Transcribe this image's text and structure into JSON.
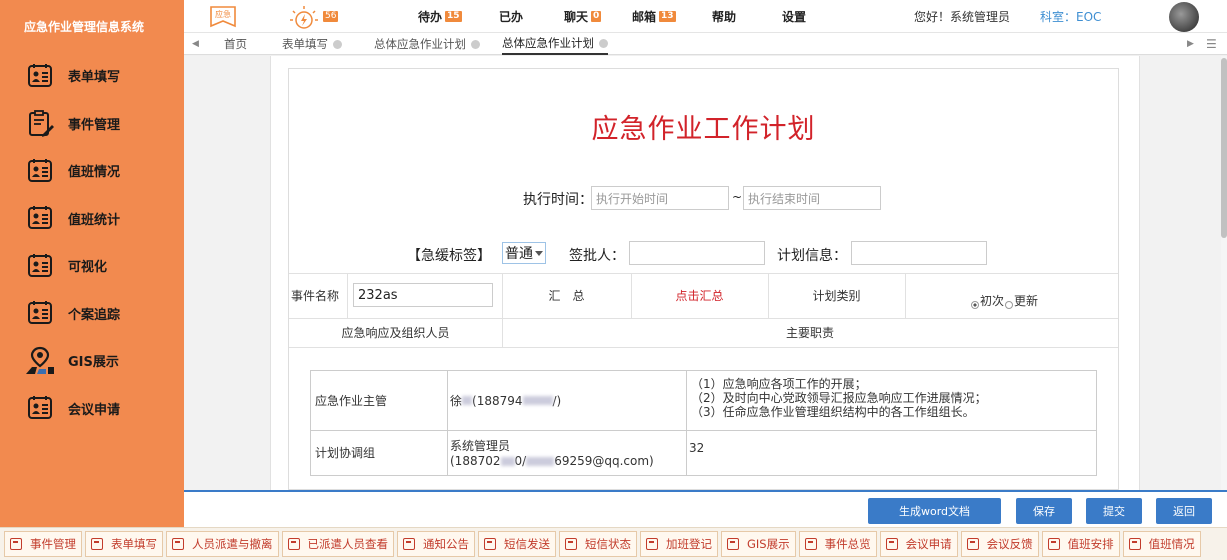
{
  "app": {
    "title": "应急作业管理信息系统"
  },
  "sidebar": {
    "items": [
      {
        "label": "表单填写",
        "icon": "form-icon"
      },
      {
        "label": "事件管理",
        "icon": "clipboard-edit-icon"
      },
      {
        "label": "值班情况",
        "icon": "form-icon"
      },
      {
        "label": "值班统计",
        "icon": "form-icon"
      },
      {
        "label": "可视化",
        "icon": "form-icon"
      },
      {
        "label": "个案追踪",
        "icon": "form-icon"
      },
      {
        "label": "GIS展示",
        "icon": "map-pin-icon"
      },
      {
        "label": "会议申请",
        "icon": "form-icon"
      }
    ]
  },
  "header": {
    "emergency_icon_text": "应急",
    "alarm_count": "56",
    "todo_label": "待办",
    "todo_count": "15",
    "done_label": "已办",
    "chat_label": "聊天",
    "chat_count": "0",
    "mail_label": "邮箱",
    "mail_count": "13",
    "help_label": "帮助",
    "settings_label": "设置",
    "greeting": "您好！系统管理员",
    "dept": "科室：EOC"
  },
  "tabs": [
    {
      "label": "首页"
    },
    {
      "label": "表单填写"
    },
    {
      "label": "总体应急作业计划"
    },
    {
      "label": "总体应急作业计划"
    }
  ],
  "form": {
    "title": "应急作业工作计划",
    "exec_time_label": "执行时间：",
    "exec_start_placeholder": "执行开始时间",
    "exec_separator": "~",
    "exec_end_placeholder": "执行结束时间",
    "urgency_label": "【急缓标签】",
    "urgency_value": "普通",
    "approver_label": "签批人：",
    "approver_value": "",
    "plan_info_label": "计划信息：",
    "plan_info_value": "",
    "event_name_label": "事件名称",
    "event_name_value": "232as",
    "summary_label": "汇　总",
    "summary_link": "点击汇总",
    "plan_type_label": "计划类别",
    "plan_type_options": [
      "初次",
      "更新"
    ],
    "col_personnel": "应急响应及组织人员",
    "col_duties": "主要职责"
  },
  "roles": [
    {
      "role": "应急作业主管",
      "person_name": "徐",
      "person_phone_prefix": "(188794",
      "person_suffix": "/)",
      "duties": [
        "（1）应急响应各项工作的开展；",
        "（2）及时向中心党政领导汇报应急响应工作进展情况；",
        "（3）任命应急作业管理组织结构中的各工作组组长。"
      ]
    },
    {
      "role": "计划协调组",
      "person_name": "系统管理员",
      "person_phone_prefix": "(188702",
      "person_mid": "0/",
      "person_email_suffix": "69259@qq.com)",
      "duties": [
        "32"
      ]
    }
  ],
  "actions": {
    "generate_word": "生成word文档",
    "save": "保存",
    "submit": "提交",
    "back": "返回"
  },
  "quicknav": [
    "事件管理",
    "表单填写",
    "人员派遣与撤离",
    "已派遣人员查看",
    "通知公告",
    "短信发送",
    "短信状态",
    "加班登记",
    "GIS展示",
    "事件总览",
    "会议申请",
    "会议反馈",
    "值班安排",
    "值班情况"
  ],
  "colors": {
    "sidebar_bg": "#f28a4f",
    "accent_blue": "#3a7bc8",
    "title_red": "#d2232a",
    "badge_orange": "#f08a3c"
  }
}
